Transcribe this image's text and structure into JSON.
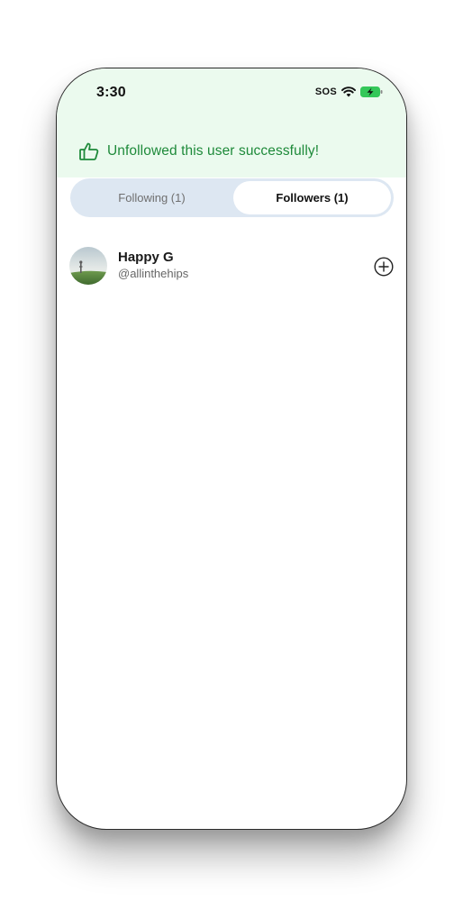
{
  "status_bar": {
    "time": "3:30",
    "sos": "SOS",
    "wifi_icon": "wifi-icon",
    "battery_icon": "battery-charging-icon"
  },
  "toast": {
    "icon": "thumbs-up-icon",
    "message": "Unfollowed this user successfully!",
    "color": "#1e8a3a",
    "background": "#ebfaee"
  },
  "tabs": [
    {
      "label": "Following (1)",
      "active": false
    },
    {
      "label": "Followers (1)",
      "active": true
    }
  ],
  "users": [
    {
      "name": "Happy G",
      "handle": "@allinthehips",
      "action_icon": "add-circle-icon"
    }
  ],
  "colors": {
    "tab_track": "#dde7f2",
    "accent_green": "#1e8a3a"
  }
}
